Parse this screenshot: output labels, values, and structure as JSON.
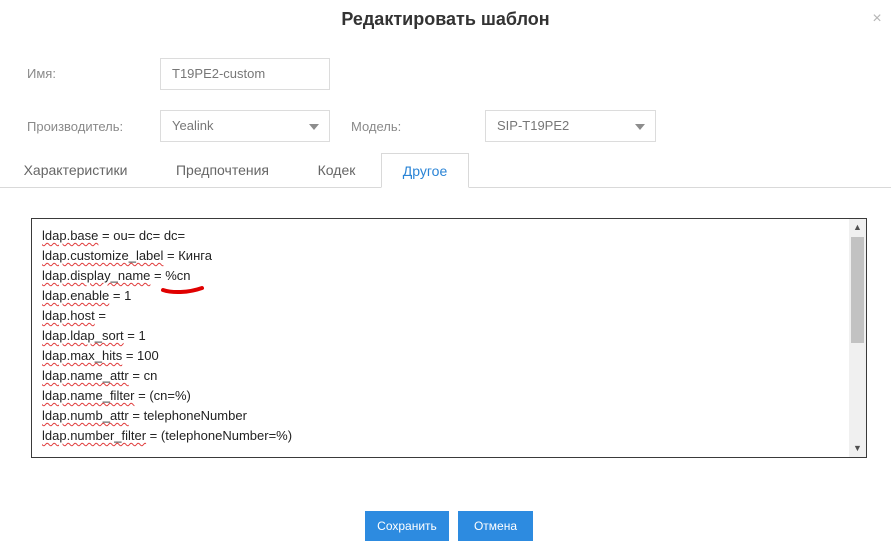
{
  "dialog": {
    "title": "Редактировать шаблон",
    "close_icon": "×"
  },
  "form": {
    "name_label": "Имя:",
    "name_value": "T19PE2-custom",
    "vendor_label": "Производитель:",
    "vendor_value": "Yealink",
    "model_label": "Модель:",
    "model_value": "SIP-T19PE2"
  },
  "tabs": [
    {
      "label": "Характеристики"
    },
    {
      "label": "Предпочтения"
    },
    {
      "label": "Кодек"
    },
    {
      "label": "Другое"
    }
  ],
  "active_tab": "Другое",
  "editor": {
    "lines": [
      {
        "key": "ldap.base",
        "value": "ou=      dc=                 dc="
      },
      {
        "key": "ldap.customize_label",
        "value": "Кинга"
      },
      {
        "key": "ldap.display_name",
        "value": "%cn"
      },
      {
        "key": "ldap.enable",
        "value": "1"
      },
      {
        "key": "ldap.host",
        "value": ""
      },
      {
        "key": "ldap.ldap_sort",
        "value": "1"
      },
      {
        "key": "ldap.max_hits",
        "value": "100"
      },
      {
        "key": "ldap.name_attr",
        "value": "cn"
      },
      {
        "key": "ldap.name_filter",
        "value": "(cn=%)"
      },
      {
        "key": "ldap.numb_attr",
        "value": "telephoneNumber"
      },
      {
        "key": "ldap.number_filter",
        "value": "(telephoneNumber=%)"
      }
    ],
    "scroll_up_icon": "▲",
    "scroll_down_icon": "▼"
  },
  "buttons": {
    "save": "Сохранить",
    "cancel": "Отмена"
  },
  "colors": {
    "accent": "#2d8be0",
    "tab_active_text": "#2a84d6",
    "annotation": "#e00000"
  }
}
